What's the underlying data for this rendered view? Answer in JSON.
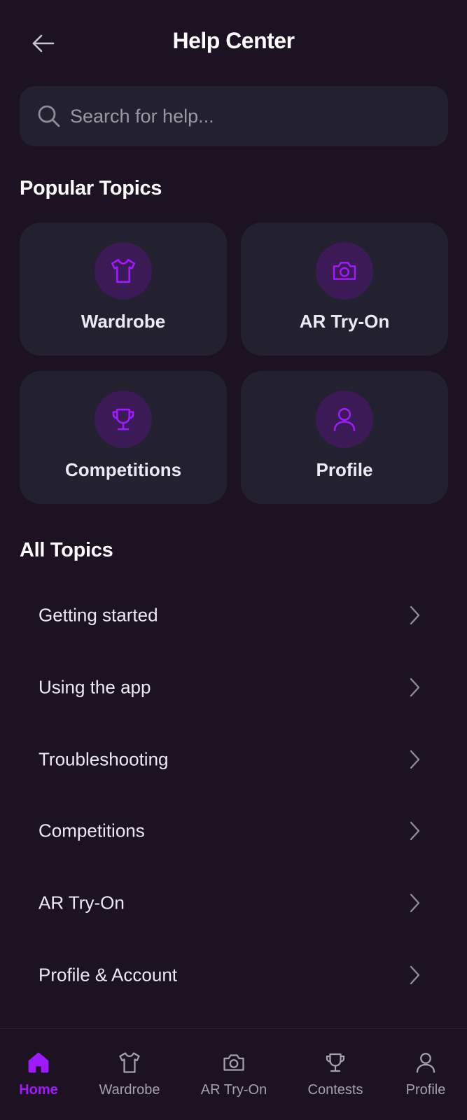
{
  "header": {
    "title": "Help Center",
    "back_icon": "arrow-left-icon"
  },
  "search": {
    "placeholder": "Search for help...",
    "icon": "search-icon"
  },
  "popular": {
    "title": "Popular Topics",
    "cards": [
      {
        "label": "Wardrobe",
        "icon": "shirt-icon"
      },
      {
        "label": "AR Try-On",
        "icon": "camera-icon"
      },
      {
        "label": "Competitions",
        "icon": "trophy-icon"
      },
      {
        "label": "Profile",
        "icon": "user-icon"
      }
    ]
  },
  "all_topics": {
    "title": "All Topics",
    "items": [
      {
        "label": "Getting started"
      },
      {
        "label": "Using the app"
      },
      {
        "label": "Troubleshooting"
      },
      {
        "label": "Competitions"
      },
      {
        "label": "AR Try-On"
      },
      {
        "label": "Profile & Account"
      }
    ]
  },
  "nav": {
    "items": [
      {
        "label": "Home",
        "icon": "home-icon",
        "active": true
      },
      {
        "label": "Wardrobe",
        "icon": "shirt-icon"
      },
      {
        "label": "AR Try-On",
        "icon": "camera-icon"
      },
      {
        "label": "Contests",
        "icon": "trophy-icon"
      },
      {
        "label": "Profile",
        "icon": "user-icon"
      }
    ]
  },
  "colors": {
    "background": "#1c1222",
    "card": "#23212f",
    "accent": "#a01aff",
    "icon_circle": "#3b1a56",
    "muted_text": "#a5a2ae"
  }
}
